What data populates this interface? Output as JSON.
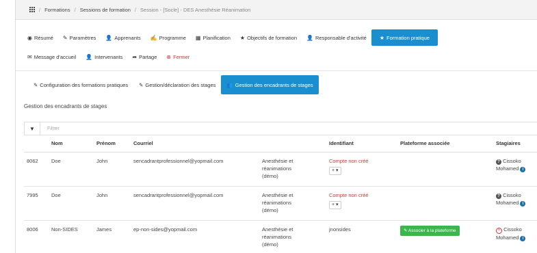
{
  "breadcrumb": {
    "items": [
      "Formations",
      "Sessions de formation",
      "Session - [Socle] - DES Anesthésie Réanimation"
    ]
  },
  "nav": {
    "row1": [
      {
        "label": "Résumé",
        "icon": "eye-icon"
      },
      {
        "label": "Paramètres",
        "icon": "wrench-icon"
      },
      {
        "label": "Apprenants",
        "icon": "user-icon"
      },
      {
        "label": "Programme",
        "icon": "edit-icon"
      },
      {
        "label": "Planification",
        "icon": "calendar-icon"
      },
      {
        "label": "Objectifs de formation",
        "icon": "star-icon"
      },
      {
        "label": "Responsable d'activité",
        "icon": "user-icon"
      },
      {
        "label": "Formation pratique",
        "icon": "star-icon"
      }
    ],
    "row2": [
      {
        "label": "Message d'accueil",
        "icon": "envelope-icon"
      },
      {
        "label": "Intervenants",
        "icon": "user-icon"
      },
      {
        "label": "Partage",
        "icon": "share-icon"
      },
      {
        "label": "Fermer",
        "icon": "close-circle-icon"
      }
    ]
  },
  "subnav": [
    {
      "label": "Configuration des formations pratiques",
      "icon": "wrench-icon"
    },
    {
      "label": "Gestion/déclaration des stages",
      "icon": "wrench-icon"
    },
    {
      "label": "Gestion des encadrants de stages",
      "icon": "users-icon"
    }
  ],
  "section_title": "Gestion des encadrants de stages",
  "filter_placeholder": "Filtrer",
  "table": {
    "headers": [
      "",
      "Nom",
      "Prénom",
      "Courriel",
      "",
      "Identifiant",
      "Plateforme associée",
      "Stagiaires"
    ],
    "rows": [
      {
        "id": "8062",
        "nom": "Doe",
        "prenom": "John",
        "courriel": "sencadrantprofessionnel@yopmail.com",
        "service": [
          "Anesthésie et",
          "réanimations",
          "(démo)"
        ],
        "identifiant": "Compte non créé",
        "plateforme": "",
        "stagiaire": [
          "Cissoko",
          "Mohamed"
        ]
      },
      {
        "id": "7995",
        "nom": "Doe",
        "prenom": "John",
        "courriel": "sencadrantprofessionnel@yopmail.com",
        "service": [
          "Anesthésie et",
          "réanimations",
          "(démo)"
        ],
        "identifiant": "Compte non créé",
        "plateforme": "",
        "stagiaire": [
          "Cissoko",
          "Mohamed"
        ]
      },
      {
        "id": "8006",
        "nom": "Non-SIDES",
        "prenom": "James",
        "courriel": "ep-non-sides@yopmail.com",
        "service": [
          "Anesthésie et",
          "réanimations",
          "(démo)"
        ],
        "identifiant": "jnonsides",
        "plateforme": "Associer à la plateforme",
        "stagiaire": [
          "Cissoko",
          "Mohamed"
        ]
      }
    ]
  },
  "dropdown_label": "+ ▾",
  "colors": {
    "accent": "#1a8fd0",
    "danger": "#dd3333",
    "success": "#3cb54a"
  }
}
